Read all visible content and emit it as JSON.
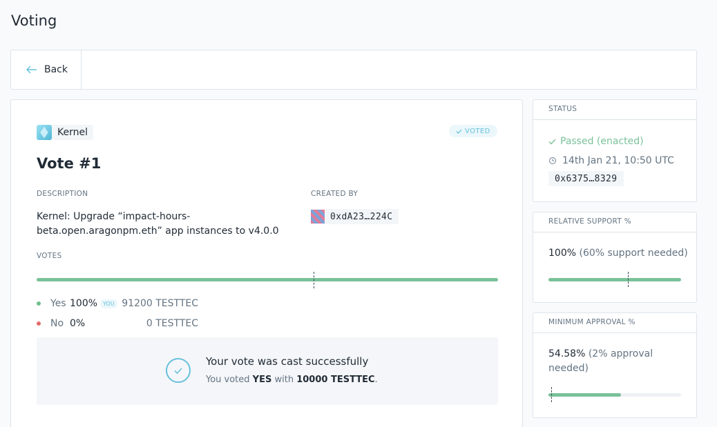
{
  "page": {
    "title": "Voting"
  },
  "nav": {
    "back_label": "Back"
  },
  "vote": {
    "app_name": "Kernel",
    "voted_label": "VOTED",
    "title": "Vote #1",
    "description_label": "DESCRIPTION",
    "description": "Kernel: Upgrade “impact-hours-beta.open.aragonpm.eth” app instances to v4.0.0",
    "created_by_label": "CREATED BY",
    "creator_address": "0xdA23…224C",
    "votes_label": "VOTES",
    "yes_fraction": 1.0,
    "support_threshold_fraction": 0.6,
    "options": [
      {
        "label": "Yes",
        "percent": "100%",
        "you_label": "YOU",
        "amount": "91200 TESTTEC",
        "color": "#6fbf8b"
      },
      {
        "label": "No",
        "percent": "0%",
        "you_label": "",
        "amount": "0 TESTTEC",
        "color": "#e46a6a"
      }
    ],
    "success": {
      "title": "Your vote was cast successfully",
      "sub_prefix": "You voted ",
      "choice": "YES",
      "sub_mid": " with ",
      "amount": "10000 TESTTEC",
      "sub_suffix": "."
    }
  },
  "status": {
    "header": "STATUS",
    "state": "Passed (enacted)",
    "time": "14th Jan 21, 10:50 UTC",
    "tx": "0x6375…8329"
  },
  "support": {
    "header": "RELATIVE SUPPORT %",
    "value": "100%",
    "note": "(60% support needed)",
    "fraction": 1.0,
    "threshold_fraction": 0.6
  },
  "approval": {
    "header": "MINIMUM APPROVAL %",
    "value": "54.58%",
    "note": "(2% approval needed)",
    "fraction": 0.5458,
    "threshold_fraction": 0.02
  },
  "colors": {
    "accent": "#67c1dc",
    "positive": "#7ac199",
    "negative": "#e46a6a"
  }
}
